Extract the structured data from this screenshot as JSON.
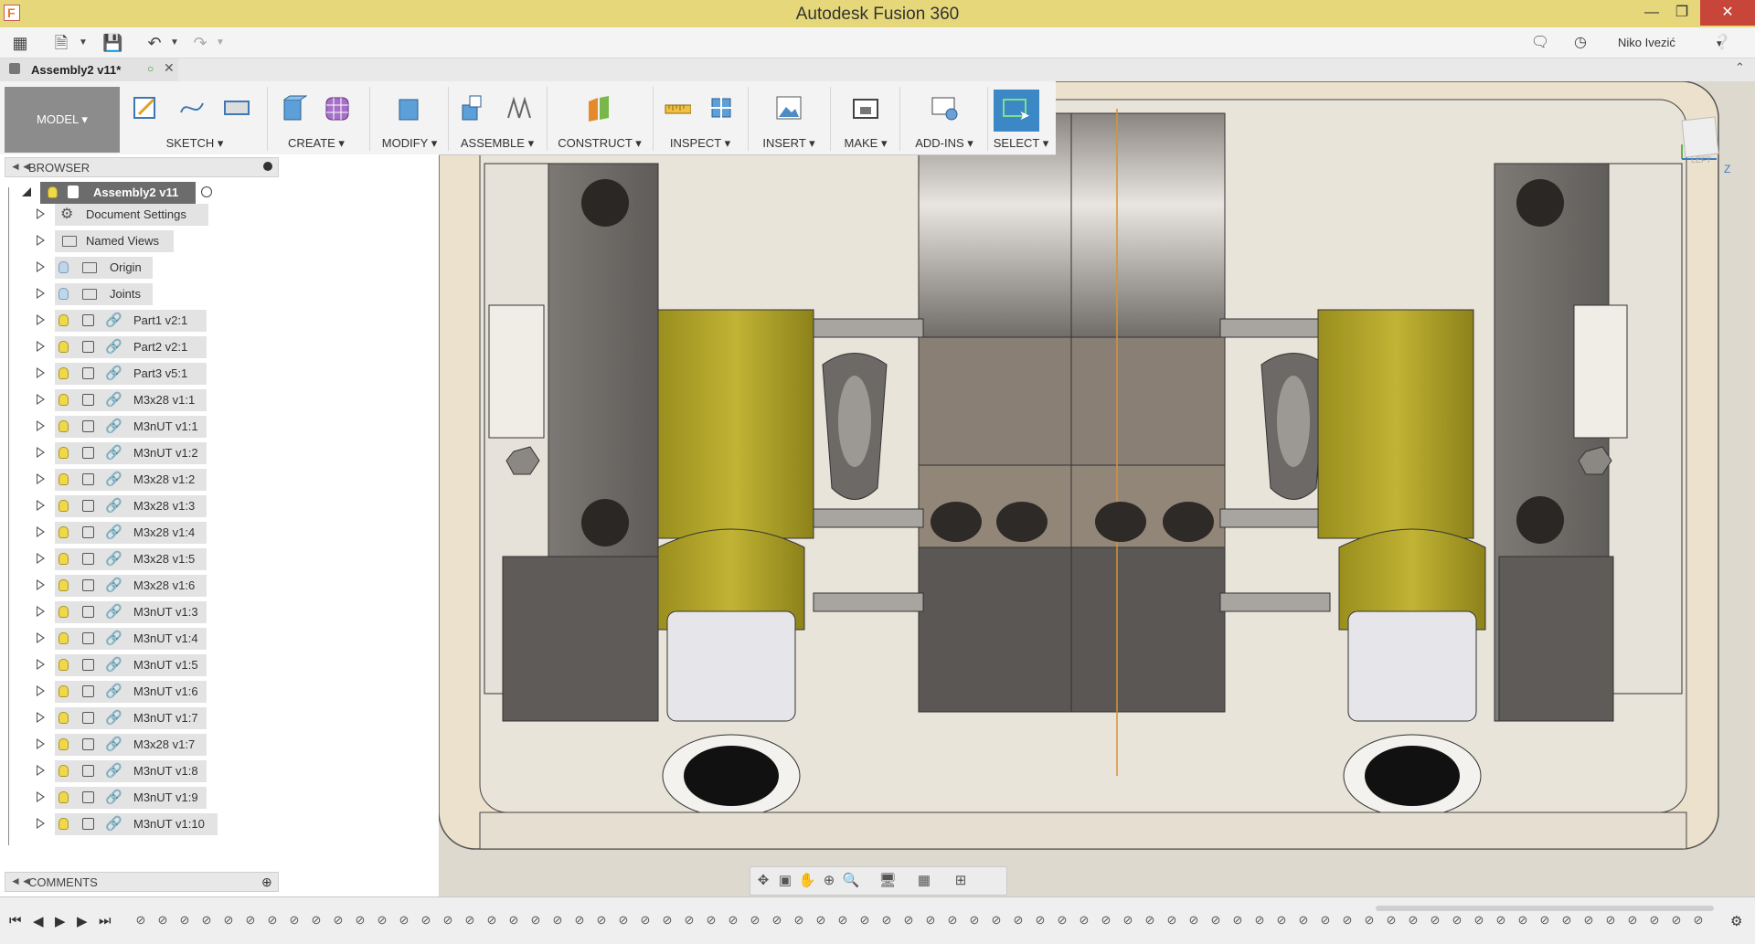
{
  "window": {
    "title": "Autodesk Fusion 360",
    "user": "Niko Ivezić"
  },
  "document_tab": {
    "label": "Assembly2 v11*"
  },
  "ribbon": {
    "workspace": "MODEL",
    "groups": [
      "SKETCH",
      "CREATE",
      "MODIFY",
      "ASSEMBLE",
      "CONSTRUCT",
      "INSPECT",
      "INSERT",
      "MAKE",
      "ADD-INS",
      "SELECT"
    ]
  },
  "browser": {
    "title": "BROWSER",
    "root": "Assembly2 v11",
    "items": [
      "Document Settings",
      "Named Views",
      "Origin",
      "Joints",
      "Part1 v2:1",
      "Part2 v2:1",
      "Part3 v5:1",
      "M3x28 v1:1",
      "M3nUT v1:1",
      "M3nUT v1:2",
      "M3x28 v1:2",
      "M3x28 v1:3",
      "M3x28 v1:4",
      "M3x28 v1:5",
      "M3x28 v1:6",
      "M3nUT v1:3",
      "M3nUT v1:4",
      "M3nUT v1:5",
      "M3nUT v1:6",
      "M3nUT v1:7",
      "M3x28 v1:7",
      "M3nUT v1:8",
      "M3nUT v1:9",
      "M3nUT v1:10"
    ]
  },
  "comments": {
    "title": "COMMENTS"
  },
  "viewcube": {
    "face": "LEFT",
    "axis": "Z"
  },
  "colors": {
    "titlebar": "#e6d87a",
    "close": "#c8453a",
    "select_active": "#3c87c5",
    "part_yellow": "#bcae2d"
  }
}
